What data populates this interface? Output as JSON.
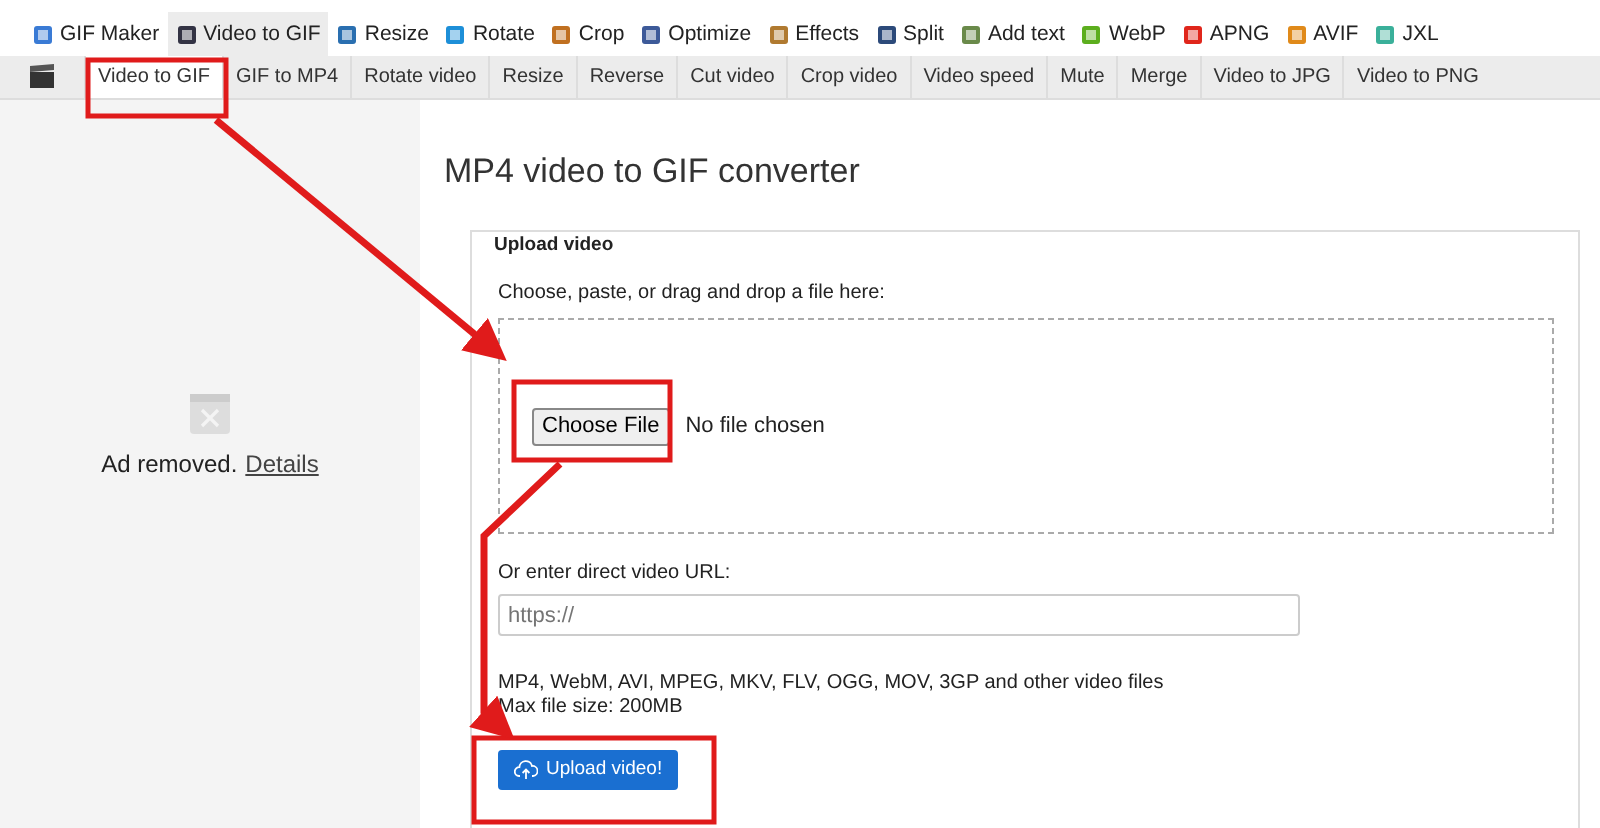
{
  "top_nav": [
    {
      "label": "GIF Maker",
      "selected": false
    },
    {
      "label": "Video to GIF",
      "selected": true
    },
    {
      "label": "Resize",
      "selected": false
    },
    {
      "label": "Rotate",
      "selected": false
    },
    {
      "label": "Crop",
      "selected": false
    },
    {
      "label": "Optimize",
      "selected": false
    },
    {
      "label": "Effects",
      "selected": false
    },
    {
      "label": "Split",
      "selected": false
    },
    {
      "label": "Add text",
      "selected": false
    },
    {
      "label": "WebP",
      "selected": false
    },
    {
      "label": "APNG",
      "selected": false
    },
    {
      "label": "AVIF",
      "selected": false
    },
    {
      "label": "JXL",
      "selected": false
    }
  ],
  "sub_nav": [
    {
      "label": "Video to GIF",
      "selected": true
    },
    {
      "label": "GIF to MP4",
      "selected": false
    },
    {
      "label": "Rotate video",
      "selected": false
    },
    {
      "label": "Resize",
      "selected": false
    },
    {
      "label": "Reverse",
      "selected": false
    },
    {
      "label": "Cut video",
      "selected": false
    },
    {
      "label": "Crop video",
      "selected": false
    },
    {
      "label": "Video speed",
      "selected": false
    },
    {
      "label": "Mute",
      "selected": false
    },
    {
      "label": "Merge",
      "selected": false
    },
    {
      "label": "Video to JPG",
      "selected": false
    },
    {
      "label": "Video to PNG",
      "selected": false
    }
  ],
  "sidebar": {
    "ad_text": "Ad removed.",
    "ad_link": "Details"
  },
  "main": {
    "title": "MP4 video to GIF converter",
    "legend": "Upload video",
    "file_prompt": "Choose, paste, or drag and drop a file here:",
    "file_button": "Choose File",
    "file_status": "No file chosen",
    "url_label": "Or enter direct video URL:",
    "url_placeholder": "https://",
    "formats": "MP4, WebM, AVI, MPEG, MKV, FLV, OGG, MOV, 3GP and other video files",
    "max_size": "Max file size: 200MB",
    "upload_button": "Upload video!"
  }
}
